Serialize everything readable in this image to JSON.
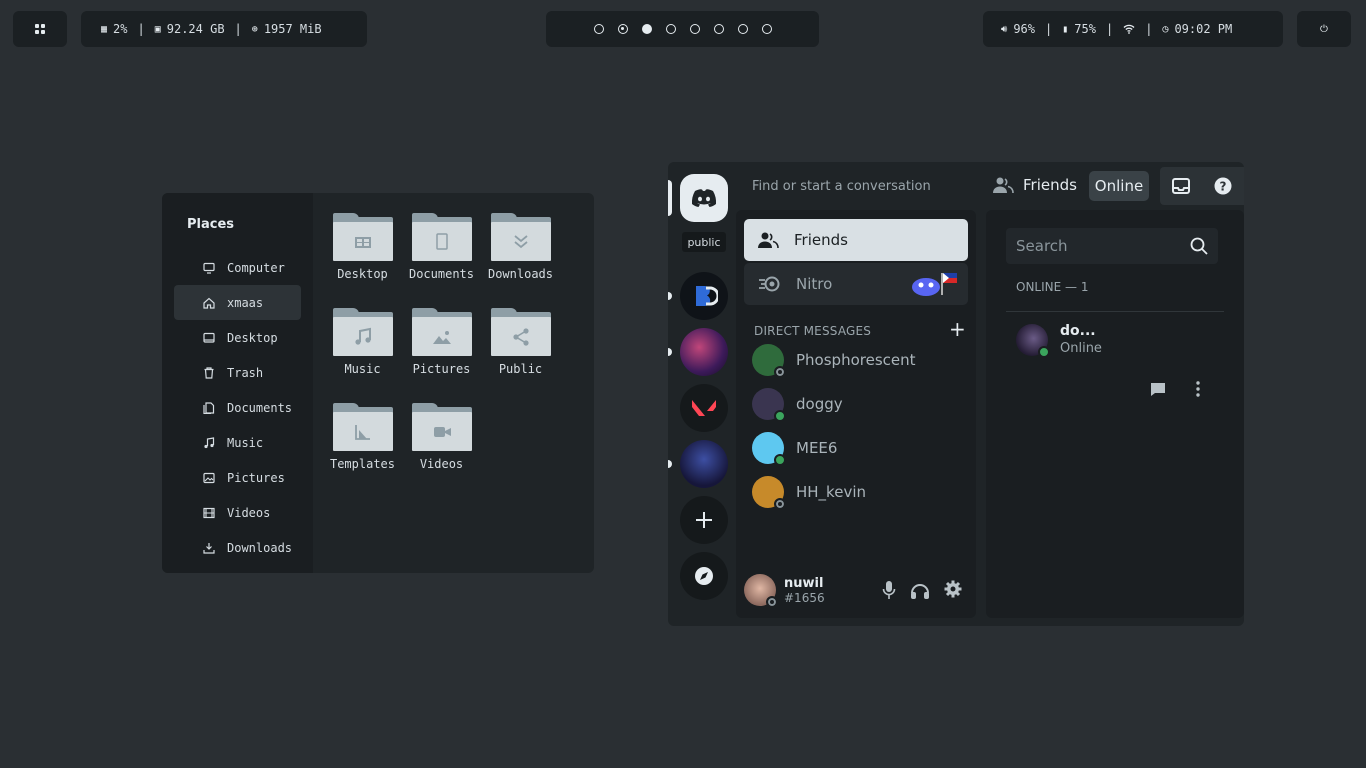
{
  "topbar": {
    "cpu": "2%",
    "disk": "92.24 GB",
    "memory": "1957 MiB",
    "workspaces": [
      "empty",
      "occupied",
      "active",
      "empty",
      "empty",
      "empty",
      "empty",
      "empty"
    ],
    "volume": "96%",
    "battery": "75%",
    "time": "09:02 PM"
  },
  "file_manager": {
    "places_title": "Places",
    "places": [
      {
        "label": "Computer",
        "icon": "monitor-icon"
      },
      {
        "label": "xmaas",
        "icon": "home-icon",
        "active": true
      },
      {
        "label": "Desktop",
        "icon": "desktop-icon"
      },
      {
        "label": "Trash",
        "icon": "trash-icon"
      },
      {
        "label": "Documents",
        "icon": "documents-icon"
      },
      {
        "label": "Music",
        "icon": "music-icon"
      },
      {
        "label": "Pictures",
        "icon": "pictures-icon"
      },
      {
        "label": "Videos",
        "icon": "videos-icon"
      },
      {
        "label": "Downloads",
        "icon": "download-icon"
      }
    ],
    "folders": [
      {
        "label": "Desktop",
        "icon": "desktop-folder-icon"
      },
      {
        "label": "Documents",
        "icon": "documents-folder-icon"
      },
      {
        "label": "Downloads",
        "icon": "downloads-folder-icon"
      },
      {
        "label": "Music",
        "icon": "music-folder-icon"
      },
      {
        "label": "Pictures",
        "icon": "pictures-folder-icon"
      },
      {
        "label": "Public",
        "icon": "public-folder-icon"
      },
      {
        "label": "Templates",
        "icon": "templates-folder-icon"
      },
      {
        "label": "Videos",
        "icon": "videos-folder-icon"
      }
    ]
  },
  "discord": {
    "tooltip": "public",
    "search_placeholder": "Find or start a conversation",
    "header_friends": "Friends",
    "header_online": "Online",
    "nav_friends": "Friends",
    "nav_nitro": "Nitro",
    "dm_title": "DIRECT MESSAGES",
    "dms": [
      {
        "name": "Phosphorescent",
        "status": "offline",
        "color": "#2f6b3c"
      },
      {
        "name": "doggy",
        "status": "online",
        "color": "#3a3550"
      },
      {
        "name": "MEE6",
        "status": "online",
        "color": "#5ec8f0"
      },
      {
        "name": "HH_kevin",
        "status": "offline",
        "color": "#c78a2a"
      }
    ],
    "user": {
      "name": "nuwil",
      "tag": "#1656"
    },
    "right_search_placeholder": "Search",
    "online_header": "ONLINE — 1",
    "friend": {
      "name": "do...",
      "status": "Online"
    },
    "colors": {
      "accent": "#e6ecf0",
      "online": "#3ba55d",
      "background": "#2a2f33"
    }
  }
}
